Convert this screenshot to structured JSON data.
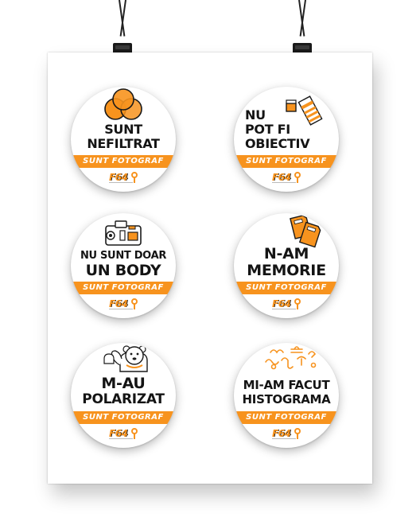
{
  "colors": {
    "accent": "#f7931e",
    "ink": "#141414",
    "poster": "#ffffff",
    "clip": "#1a1a1a"
  },
  "poster": {
    "stickers": [
      {
        "id": "nefiltrat",
        "lines": [
          "SUNT",
          "NEFILTRAT"
        ],
        "tagline": "SUNT FOTOGRAF",
        "logo": "F64",
        "icon": "filter-circles-icon"
      },
      {
        "id": "obiectiv",
        "lines": [
          "NU",
          "POT FI",
          "OBIECTIV"
        ],
        "tagline": "SUNT FOTOGRAF",
        "logo": "F64",
        "icon": "lens-icon"
      },
      {
        "id": "body",
        "lines": [
          "NU SUNT DOAR",
          "UN BODY"
        ],
        "tagline": "SUNT FOTOGRAF",
        "logo": "F64",
        "icon": "camera-body-icon"
      },
      {
        "id": "memorie",
        "lines": [
          "N-AM",
          "MEMORIE"
        ],
        "tagline": "SUNT FOTOGRAF",
        "logo": "F64",
        "icon": "memory-cards-icon"
      },
      {
        "id": "polarizat",
        "lines": [
          "M-AU",
          "POLARIZAT"
        ],
        "tagline": "SUNT FOTOGRAF",
        "logo": "F64",
        "icon": "polar-bear-icon"
      },
      {
        "id": "histograma",
        "lines": [
          "MI-AM FACUT",
          "HISTOGRAMA"
        ],
        "tagline": "SUNT FOTOGRAF",
        "logo": "F64",
        "icon": "zodiac-signs-icon"
      }
    ]
  }
}
